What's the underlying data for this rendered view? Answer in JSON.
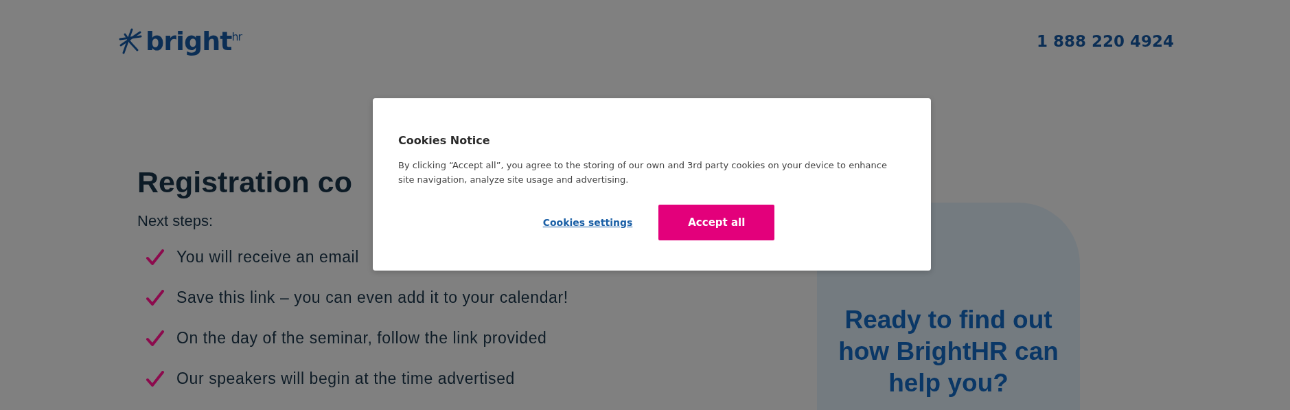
{
  "header": {
    "logo": {
      "text": "bright",
      "superscript": "hr"
    },
    "phone": "1 888 220 4924"
  },
  "main": {
    "heading": "Registration co",
    "subheading": "Next steps:",
    "steps": [
      "You will receive an email",
      "Save this link – you can even add it to your calendar!",
      "On the day of the seminar, follow the link provided",
      "Our speakers will begin at the time advertised"
    ]
  },
  "promo_card": {
    "title": "Ready to find out how BrightHR can help you?"
  },
  "cookie_dialog": {
    "title": "Cookies Notice",
    "body": "By clicking “Accept all”, you agree to the storing of our own and 3rd party cookies on your device to enhance site navigation, analyze site usage and advertising.",
    "settings_link": "Cookies settings",
    "accept_button": "Accept all"
  }
}
